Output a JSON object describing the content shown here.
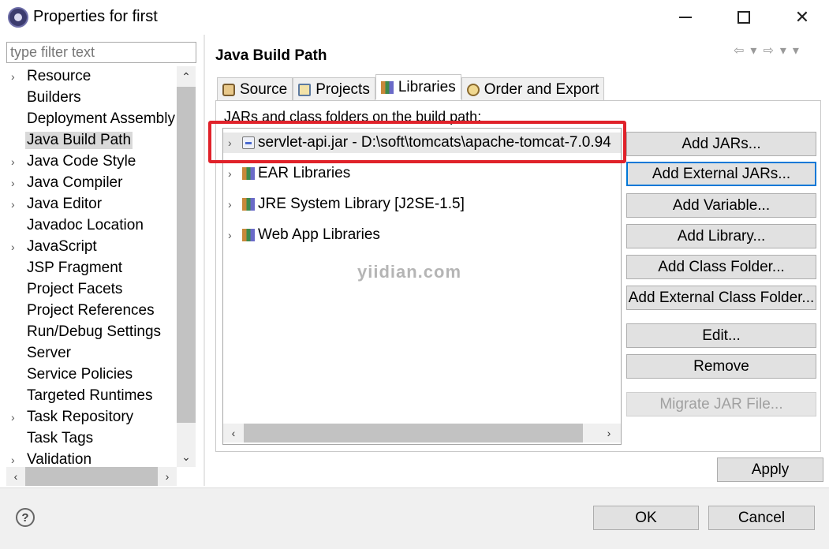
{
  "window": {
    "title": "Properties for first",
    "minimize_icon": "minimize-icon",
    "maximize_icon": "maximize-icon",
    "close_icon": "close-icon"
  },
  "filter": {
    "placeholder": "type filter text"
  },
  "tree": {
    "selected": "Java Build Path",
    "items": [
      {
        "label": "Resource",
        "expandable": true
      },
      {
        "label": "Builders",
        "expandable": false
      },
      {
        "label": "Deployment Assembly",
        "expandable": false
      },
      {
        "label": "Java Build Path",
        "expandable": false
      },
      {
        "label": "Java Code Style",
        "expandable": true
      },
      {
        "label": "Java Compiler",
        "expandable": true
      },
      {
        "label": "Java Editor",
        "expandable": true
      },
      {
        "label": "Javadoc Location",
        "expandable": false
      },
      {
        "label": "JavaScript",
        "expandable": true
      },
      {
        "label": "JSP Fragment",
        "expandable": false
      },
      {
        "label": "Project Facets",
        "expandable": false
      },
      {
        "label": "Project References",
        "expandable": false
      },
      {
        "label": "Run/Debug Settings",
        "expandable": false
      },
      {
        "label": "Server",
        "expandable": false
      },
      {
        "label": "Service Policies",
        "expandable": false
      },
      {
        "label": "Targeted Runtimes",
        "expandable": false
      },
      {
        "label": "Task Repository",
        "expandable": true
      },
      {
        "label": "Task Tags",
        "expandable": false
      },
      {
        "label": "Validation",
        "expandable": true
      }
    ]
  },
  "page": {
    "title": "Java Build Path"
  },
  "tabs": [
    {
      "label": "Source",
      "icon": "source-folder-icon",
      "active": false
    },
    {
      "label": "Projects",
      "icon": "projects-icon",
      "active": false
    },
    {
      "label": "Libraries",
      "icon": "libraries-icon",
      "active": true
    },
    {
      "label": "Order and Export",
      "icon": "order-export-icon",
      "active": false
    }
  ],
  "libraries": {
    "heading": "JARs and class folders on the build path:",
    "items": [
      {
        "label": "servlet-api.jar - D:\\soft\\tomcats\\apache-tomcat-7.0.94",
        "icon": "jar-icon",
        "selected": true
      },
      {
        "label": "EAR Libraries",
        "icon": "library-icon",
        "selected": false
      },
      {
        "label": "JRE System Library [J2SE-1.5]",
        "icon": "library-icon",
        "selected": false
      },
      {
        "label": "Web App Libraries",
        "icon": "library-icon",
        "selected": false
      }
    ]
  },
  "buttons": {
    "add_jars": "Add JARs...",
    "add_external_jars": "Add External JARs...",
    "add_variable": "Add Variable...",
    "add_library": "Add Library...",
    "add_class_folder": "Add Class Folder...",
    "add_external_class_folder": "Add External Class Folder...",
    "edit": "Edit...",
    "remove": "Remove",
    "migrate_jar": "Migrate JAR File...",
    "apply": "Apply",
    "ok": "OK",
    "cancel": "Cancel"
  },
  "watermark": "yiidian.com",
  "colors": {
    "highlight": "#e0222a",
    "focus": "#0078d7"
  }
}
